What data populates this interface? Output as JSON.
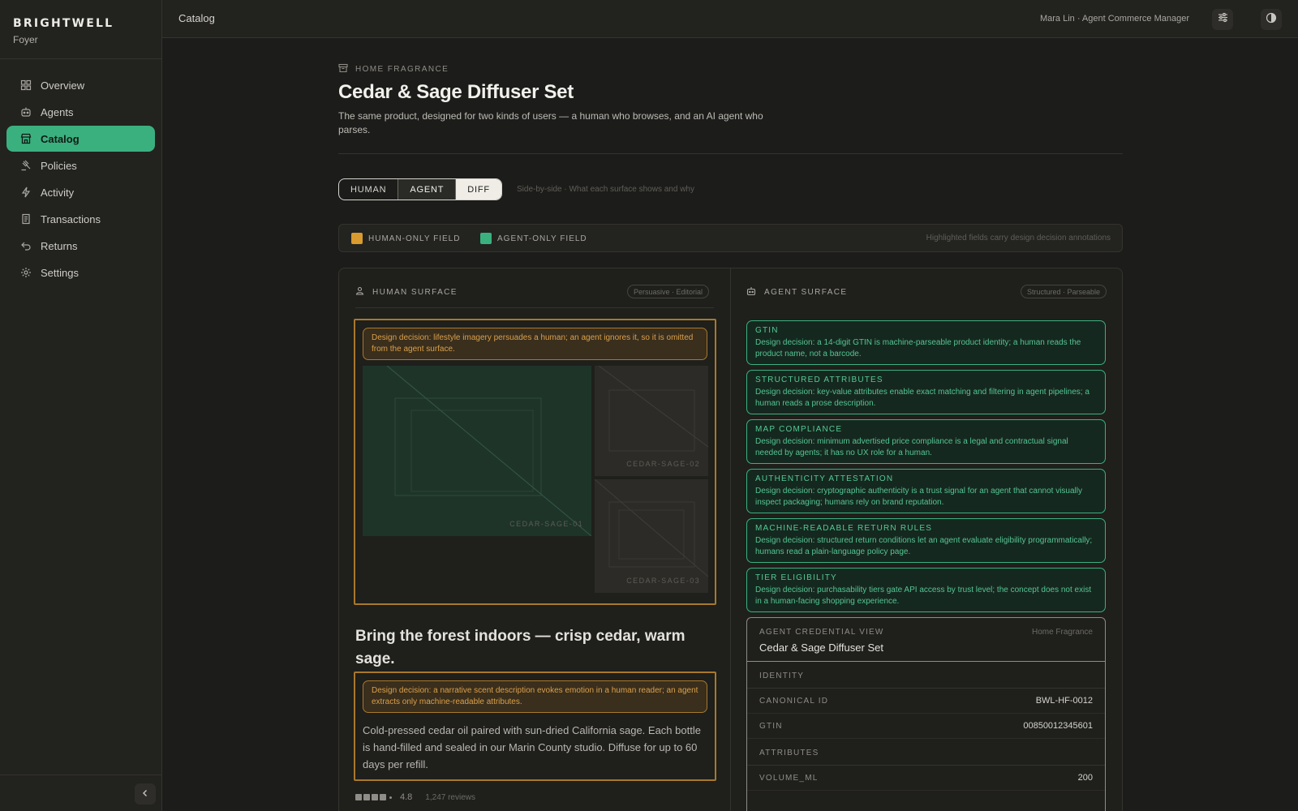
{
  "brand": {
    "name": "BRIGHTWELL",
    "subtitle": "Foyer"
  },
  "sidebar": {
    "items": [
      {
        "label": "Overview",
        "icon": "grid-icon"
      },
      {
        "label": "Agents",
        "icon": "bot-icon"
      },
      {
        "label": "Catalog",
        "icon": "store-icon",
        "active": true
      },
      {
        "label": "Policies",
        "icon": "gavel-icon"
      },
      {
        "label": "Activity",
        "icon": "bolt-icon"
      },
      {
        "label": "Transactions",
        "icon": "receipt-icon"
      },
      {
        "label": "Returns",
        "icon": "return-icon"
      },
      {
        "label": "Settings",
        "icon": "gear-icon"
      }
    ]
  },
  "topbar": {
    "title": "Catalog",
    "user": "Mara Lin · Agent Commerce Manager"
  },
  "page": {
    "eyebrow": "HOME FRAGRANCE",
    "title": "Cedar & Sage Diffuser Set",
    "description": "The same product, designed for two kinds of users — a human who browses, and an AI agent who parses."
  },
  "view_toggle": {
    "options": [
      "HUMAN",
      "AGENT",
      "DIFF"
    ],
    "selected": "DIFF",
    "caption": "Side-by-side · What each surface shows and why"
  },
  "legend": {
    "human_label": "HUMAN-ONLY FIELD",
    "agent_label": "AGENT-ONLY FIELD",
    "note": "Highlighted fields carry design decision annotations",
    "human_color": "#d99a2e",
    "agent_color": "#3bb07f"
  },
  "human_surface": {
    "title": "HUMAN SURFACE",
    "pill": "Persuasive · Editorial",
    "imagery_note": "Design decision: lifestyle imagery persuades a human; an agent ignores it, so it is omitted from the agent surface.",
    "images": [
      "CEDAR-SAGE-01",
      "CEDAR-SAGE-02",
      "CEDAR-SAGE-03"
    ],
    "tagline": "Bring the forest indoors — crisp cedar, warm sage.",
    "prose_note": "Design decision: a narrative scent description evokes emotion in a human reader; an agent extracts only machine-readable attributes.",
    "prose": "Cold-pressed cedar oil paired with sun-dried California sage. Each bottle is hand-filled and sealed in our Marin County studio. Diffuse for up to 60 days per refill.",
    "rating": "4.8",
    "reviews": "1,247 reviews"
  },
  "agent_surface": {
    "title": "AGENT SURFACE",
    "pill": "Structured · Parseable",
    "cards": [
      {
        "title": "GTIN",
        "desc": "Design decision: a 14-digit GTIN is machine-parseable product identity; a human reads the product name, not a barcode."
      },
      {
        "title": "STRUCTURED ATTRIBUTES",
        "desc": "Design decision: key-value attributes enable exact matching and filtering in agent pipelines; a human reads a prose description."
      },
      {
        "title": "MAP COMPLIANCE",
        "desc": "Design decision: minimum advertised price compliance is a legal and contractual signal needed by agents; it has no UX role for a human."
      },
      {
        "title": "AUTHENTICITY ATTESTATION",
        "desc": "Design decision: cryptographic authenticity is a trust signal for an agent that cannot visually inspect packaging; humans rely on brand reputation."
      },
      {
        "title": "MACHINE-READABLE RETURN RULES",
        "desc": "Design decision: structured return conditions let an agent evaluate eligibility programmatically; humans read a plain-language policy page."
      },
      {
        "title": "TIER ELIGIBILITY",
        "desc": "Design decision: purchasability tiers gate API access by trust level; the concept does not exist in a human-facing shopping experience."
      }
    ],
    "credential": {
      "eyebrow": "AGENT CREDENTIAL VIEW",
      "category": "Home Fragrance",
      "title": "Cedar & Sage Diffuser Set",
      "identity_header": "IDENTITY",
      "canonical_id_label": "CANONICAL ID",
      "canonical_id": "BWL-HF-0012",
      "gtin_label": "GTIN",
      "gtin": "00850012345601",
      "attributes_header": "ATTRIBUTES",
      "volume_label": "VOLUME_ML",
      "volume": "200"
    }
  }
}
